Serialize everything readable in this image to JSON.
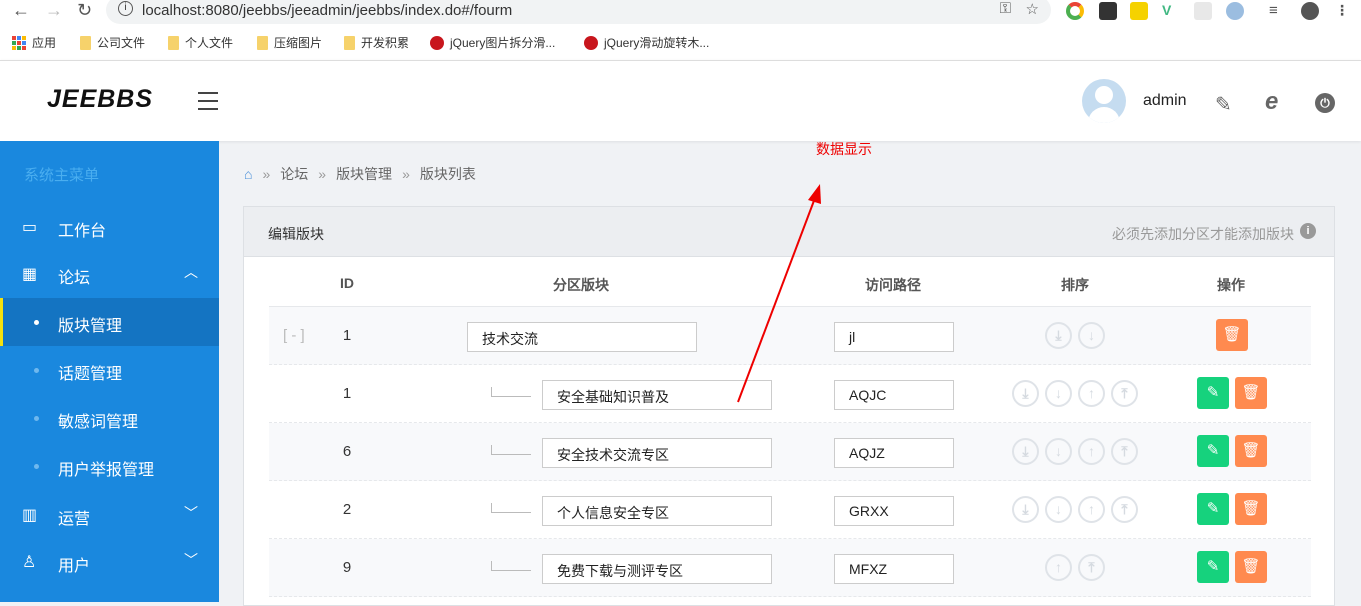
{
  "browser": {
    "url": "localhost:8080/jeebbs/jeeadmin/jeebbs/index.do#/fourm",
    "bookmarks": [
      "应用",
      "公司文件",
      "个人文件",
      "压缩图片",
      "开发积累",
      "jQuery图片拆分滑...",
      "jQuery滑动旋转木..."
    ]
  },
  "header": {
    "logo": "JEEBBS",
    "username": "admin"
  },
  "sidebar": {
    "title": "系统主菜单",
    "items": [
      {
        "label": "工作台",
        "icon": "monitor-icon"
      },
      {
        "label": "论坛",
        "icon": "grid-icon"
      },
      {
        "label": "版块管理",
        "active": true
      },
      {
        "label": "话题管理"
      },
      {
        "label": "敏感词管理"
      },
      {
        "label": "用户举报管理"
      },
      {
        "label": "运营",
        "icon": "chart-icon"
      },
      {
        "label": "用户",
        "icon": "user-icon"
      }
    ]
  },
  "breadcrumb": [
    "论坛",
    "版块管理",
    "版块列表"
  ],
  "annotation": "数据显示",
  "card": {
    "title": "编辑版块",
    "notice": "必须先添加分区才能添加版块"
  },
  "table": {
    "headers": [
      "ID",
      "分区版块",
      "访问路径",
      "排序",
      "操作"
    ],
    "rows": [
      {
        "id": "1",
        "name": "技术交流",
        "path": "jl",
        "toggle": "[ - ]"
      },
      {
        "id": "1",
        "name": "安全基础知识普及",
        "path": "AQJC"
      },
      {
        "id": "6",
        "name": "安全技术交流专区",
        "path": "AQJZ"
      },
      {
        "id": "2",
        "name": "个人信息安全专区",
        "path": "GRXX"
      },
      {
        "id": "9",
        "name": "免费下载与测评专区",
        "path": "MFXZ"
      }
    ]
  },
  "colors": {
    "sidebar": "#1a88de",
    "edit": "#16d27d",
    "delete": "#ff8a4f",
    "annotation": "#ee0000"
  }
}
